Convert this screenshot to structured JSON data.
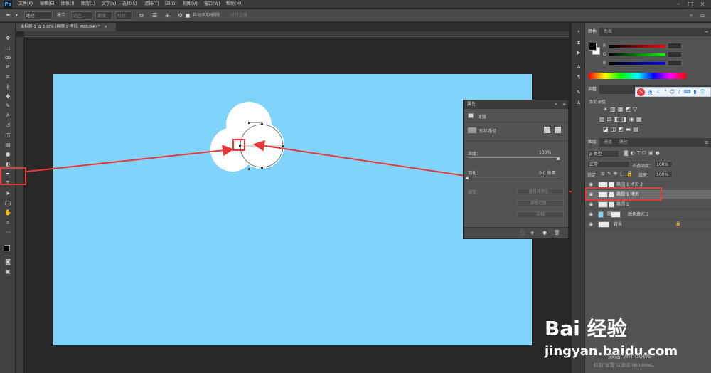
{
  "menubar": {
    "logo": "Ps",
    "items": [
      "文件(F)",
      "编辑(E)",
      "图像(I)",
      "图层(L)",
      "文字(Y)",
      "选择(S)",
      "滤镜(T)",
      "3D(D)",
      "视图(V)",
      "窗口(W)",
      "帮助(H)"
    ]
  },
  "options": {
    "mode": "路径",
    "make": "建立：",
    "selection": "选区...",
    "mask": "蒙版",
    "shape": "形状",
    "auto_add": "自动添加/删除",
    "align_edges": "对齐边缘"
  },
  "doc_tab": {
    "title": "未标题-1 @ 100% (椭圆 1 拷贝, RGB/8#) *",
    "close": "×"
  },
  "props": {
    "header": "属性",
    "section": "蒙版",
    "path_label": "形状路径",
    "density_label": "浓度：",
    "density_value": "100%",
    "feather_label": "羽化：",
    "feather_value": "0.0 像素",
    "adjust_label": "调整：",
    "btn_select": "选择并遮住...",
    "btn_range": "颜色范围...",
    "btn_invert": "反相"
  },
  "color_panel": {
    "tabs": [
      "颜色",
      "色板"
    ],
    "r_label": "R",
    "g_label": "G",
    "b_label": "B",
    "r": "0",
    "g": "0",
    "b": "0"
  },
  "adjust_panel": {
    "tabs": [
      "调整"
    ],
    "add_label": "添加调整"
  },
  "sogou": {
    "label": "英"
  },
  "layers_panel": {
    "tabs": [
      "图层",
      "通道",
      "路径"
    ],
    "kind": "ρ 类型",
    "blend": "正常",
    "opacity_label": "不透明度：",
    "opacity": "100%",
    "lock_label": "锁定：",
    "fill_label": "填充：",
    "fill": "100%",
    "layers": [
      {
        "name": "椭圆 1 拷贝 2"
      },
      {
        "name": "椭圆 1 拷贝"
      },
      {
        "name": "椭圆 1"
      },
      {
        "name": "颜色填充 1"
      },
      {
        "name": "背景"
      }
    ]
  },
  "watermark": {
    "brand": "Bai  经验",
    "url": "jingyan.baidu.com"
  },
  "windows_activation": {
    "line1": "激活 Windows",
    "line2": "转到\"设置\"以激活 Windows。"
  },
  "colors": {
    "canvas": "#80d4fb",
    "annotation_red": "#e8383a",
    "ps_blue": "#31a8ff"
  }
}
